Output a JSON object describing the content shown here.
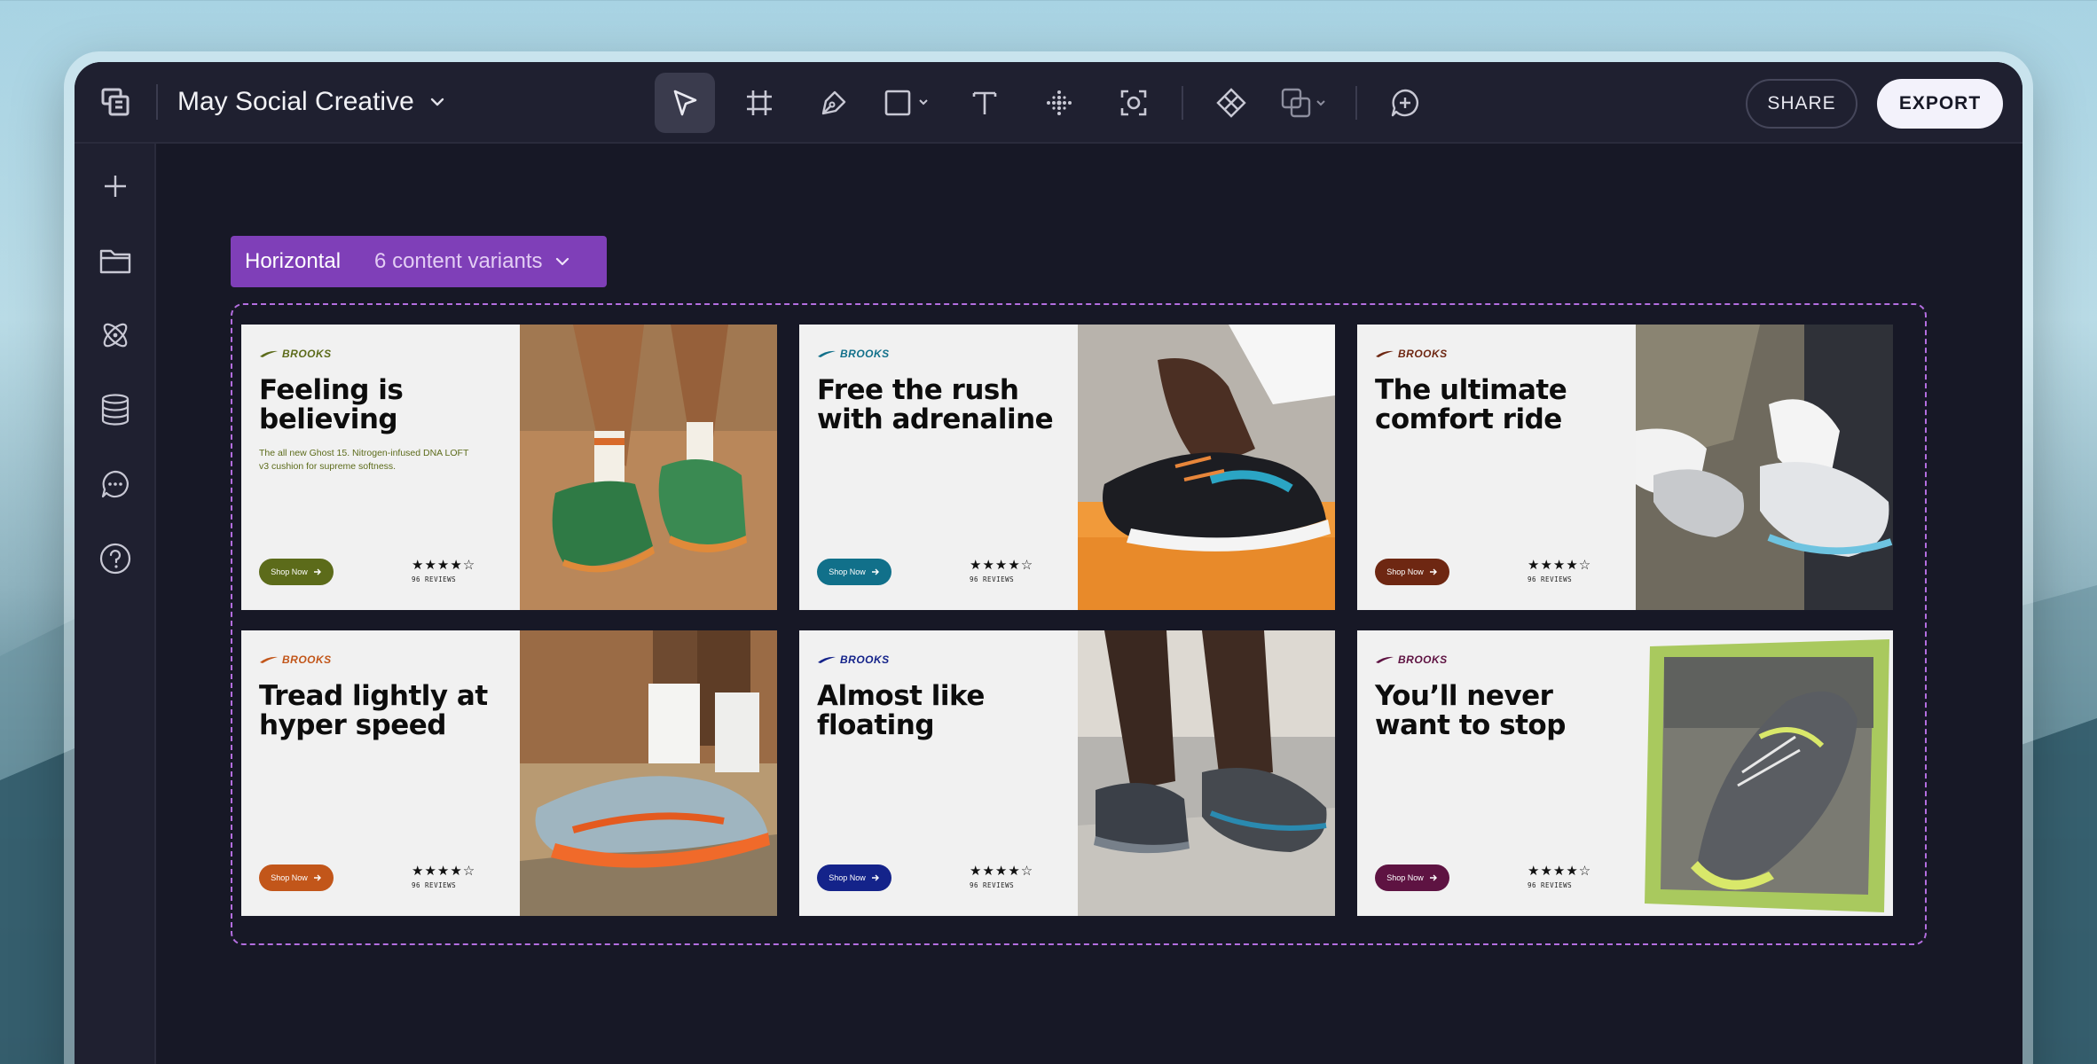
{
  "header": {
    "doc_title": "May Social Creative",
    "share_label": "SHARE",
    "export_label": "EXPORT"
  },
  "toolbar": {
    "tools": [
      "pointer-tool",
      "frame-tool",
      "pen-tool",
      "rectangle-tool",
      "text-tool",
      "grid-tool",
      "capture-tool",
      "component-tool",
      "boolean-tool",
      "comment-tool"
    ],
    "active": "pointer-tool"
  },
  "sidebar": {
    "icons": [
      "plus-icon",
      "folder-icon",
      "atom-icon",
      "database-icon",
      "chat-icon",
      "help-icon"
    ]
  },
  "variant_chip": {
    "name": "Horizontal",
    "count": "6 content variants"
  },
  "cards": [
    {
      "brand": "BROOKS",
      "headline": "Feeling is believing",
      "subcopy": "The all new Ghost 15. Nitrogen-infused DNA LOFT v3 cushion for supreme softness.",
      "cta": "Shop Now",
      "stars": "★★★★☆",
      "reviews": "96 REVIEWS",
      "accent": "#5c6b1a"
    },
    {
      "brand": "BROOKS",
      "headline": "Free the rush with adrenaline",
      "subcopy": "",
      "cta": "Shop Now",
      "stars": "★★★★☆",
      "reviews": "96 REVIEWS",
      "accent": "#11708a"
    },
    {
      "brand": "BROOKS",
      "headline": "The ultimate comfort ride",
      "subcopy": "",
      "cta": "Shop Now",
      "stars": "★★★★☆",
      "reviews": "96 REVIEWS",
      "accent": "#6e2712"
    },
    {
      "brand": "BROOKS",
      "headline": "Tread lightly at hyper speed",
      "subcopy": "",
      "cta": "Shop Now",
      "stars": "★★★★☆",
      "reviews": "96 REVIEWS",
      "accent": "#c2561a"
    },
    {
      "brand": "BROOKS",
      "headline": "Almost like floating",
      "subcopy": "",
      "cta": "Shop Now",
      "stars": "★★★★☆",
      "reviews": "96 REVIEWS",
      "accent": "#14238a"
    },
    {
      "brand": "BROOKS",
      "headline": "You’ll never want to stop",
      "subcopy": "",
      "cta": "Shop Now",
      "stars": "★★★★☆",
      "reviews": "96 REVIEWS",
      "accent": "#5e1342"
    }
  ]
}
